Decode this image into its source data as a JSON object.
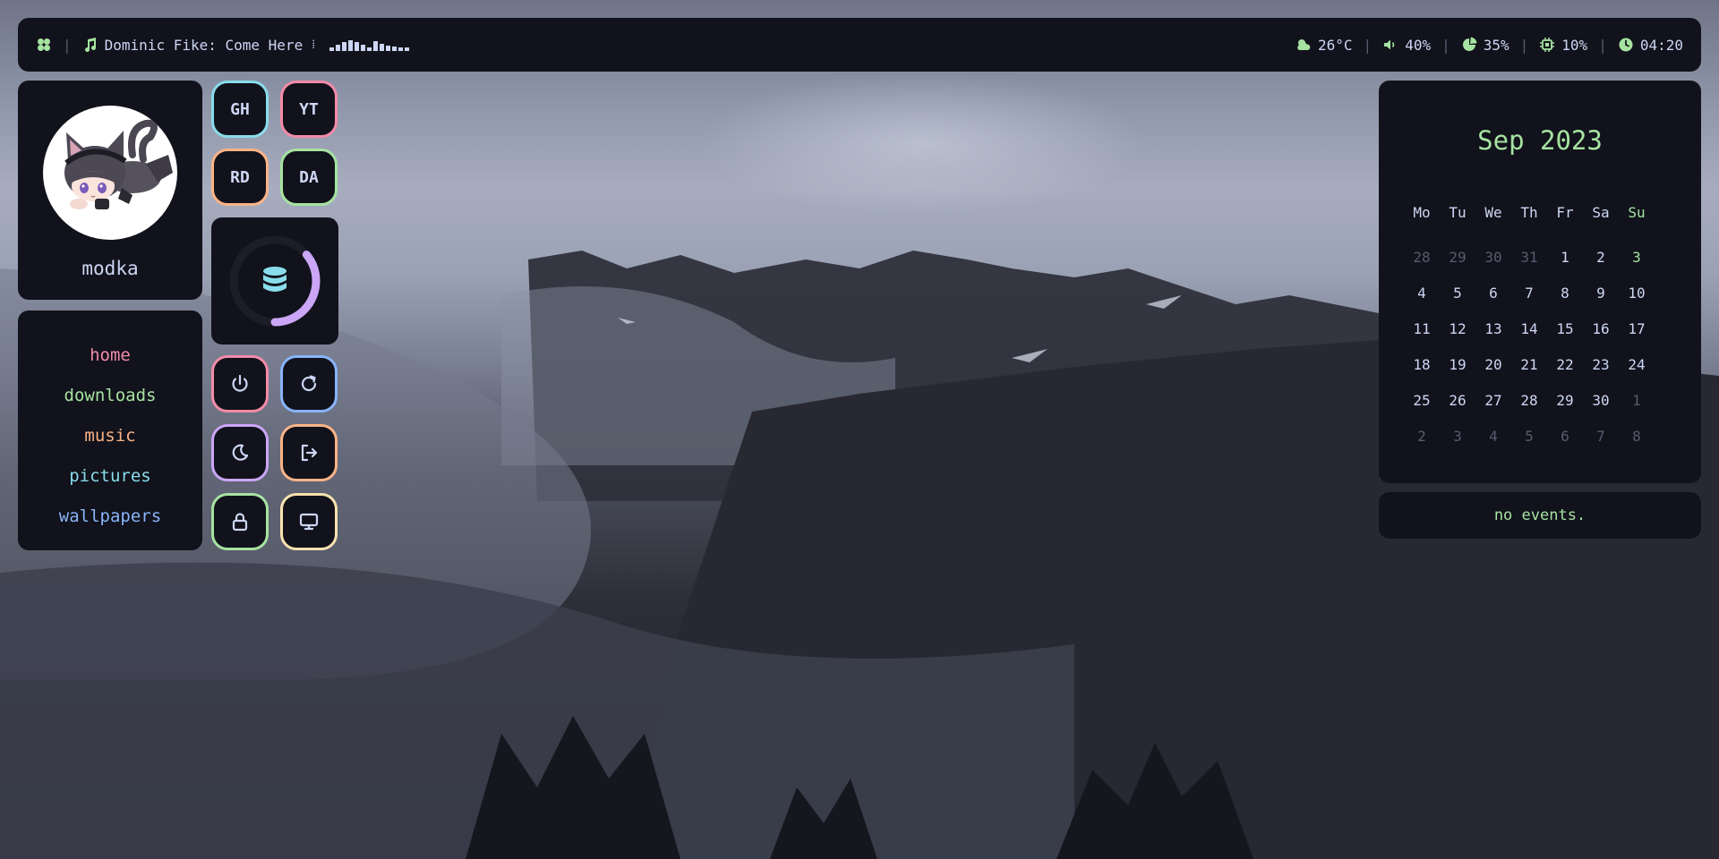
{
  "topbar": {
    "workspace_icon": "clover-icon",
    "music_icon": "music-note-icon",
    "now_playing": "Dominic Fike: Come Here",
    "visualizer_levels": [
      0.25,
      0.5,
      0.7,
      0.85,
      0.7,
      0.5,
      0.3,
      0.8,
      0.55,
      0.45,
      0.35,
      0.3,
      0.25
    ],
    "status": [
      {
        "icon": "weather-icon",
        "value": "26°C"
      },
      {
        "icon": "volume-icon",
        "value": "40%"
      },
      {
        "icon": "memory-pie-icon",
        "value": "35%"
      },
      {
        "icon": "cpu-icon",
        "value": "10%"
      },
      {
        "icon": "clock-icon",
        "value": "04:20"
      }
    ]
  },
  "profile": {
    "username": "modka"
  },
  "folders": [
    {
      "label": "home",
      "color": "#f38ba8"
    },
    {
      "label": "downloads",
      "color": "#a6e3a1"
    },
    {
      "label": "music",
      "color": "#fab387"
    },
    {
      "label": "pictures",
      "color": "#89dceb"
    },
    {
      "label": "wallpapers",
      "color": "#89b4fa"
    }
  ],
  "shortcuts": [
    {
      "label": "GH",
      "color": "#89dceb"
    },
    {
      "label": "YT",
      "color": "#f38ba8"
    },
    {
      "label": "RD",
      "color": "#fab387"
    },
    {
      "label": "DA",
      "color": "#a6e3a1"
    }
  ],
  "disk": {
    "icon": "database-icon",
    "usage": 0.36,
    "color": "#cba6f7",
    "icon_color": "#89dceb"
  },
  "power_buttons": [
    {
      "icon": "power-icon",
      "color": "#f38ba8"
    },
    {
      "icon": "reboot-icon",
      "color": "#89b4fa"
    },
    {
      "icon": "sleep-moon-icon",
      "color": "#cba6f7"
    },
    {
      "icon": "logout-icon",
      "color": "#fab387"
    },
    {
      "icon": "lock-icon",
      "color": "#a6e3a1"
    },
    {
      "icon": "monitor-icon",
      "color": "#f9e2af"
    }
  ],
  "calendar": {
    "title": "Sep 2023",
    "weekdays": [
      "Mo",
      "Tu",
      "We",
      "Th",
      "Fr",
      "Sa",
      "Su"
    ],
    "weeks": [
      [
        "28",
        "29",
        "30",
        "31",
        "1",
        "2",
        "3"
      ],
      [
        "4",
        "5",
        "6",
        "7",
        "8",
        "9",
        "10"
      ],
      [
        "11",
        "12",
        "13",
        "14",
        "15",
        "16",
        "17"
      ],
      [
        "18",
        "19",
        "20",
        "21",
        "22",
        "23",
        "24"
      ],
      [
        "25",
        "26",
        "27",
        "28",
        "29",
        "30",
        "1"
      ],
      [
        "2",
        "3",
        "4",
        "5",
        "6",
        "7",
        "8"
      ]
    ],
    "events_text": "no events."
  }
}
